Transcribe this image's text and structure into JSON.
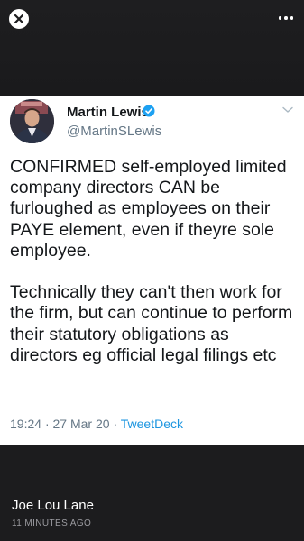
{
  "tweet": {
    "author_name": "Martin Lewis",
    "handle": "@MartinSLewis",
    "text": "CONFIRMED self-employed limited company directors CAN be furloughed as employees on their PAYE element, even if theyre sole employee.\n\nTechnically they can't then work for the firm, but can continue to perform their statutory obligations as directors eg official legal filings etc",
    "time": "19:24",
    "date": "27 Mar 20",
    "source": "TweetDeck"
  },
  "post": {
    "author": "Joe Lou Lane",
    "time_ago": "11 MINUTES AGO"
  },
  "icons": {
    "close": "close-icon",
    "more": "more-icon",
    "verified": "verified-badge-icon",
    "chevron": "chevron-down-icon"
  },
  "colors": {
    "background": "#1c1c1e",
    "card": "#ffffff",
    "verified_blue": "#1da1f2",
    "link": "#1b95e0",
    "secondary_text": "#657786"
  }
}
